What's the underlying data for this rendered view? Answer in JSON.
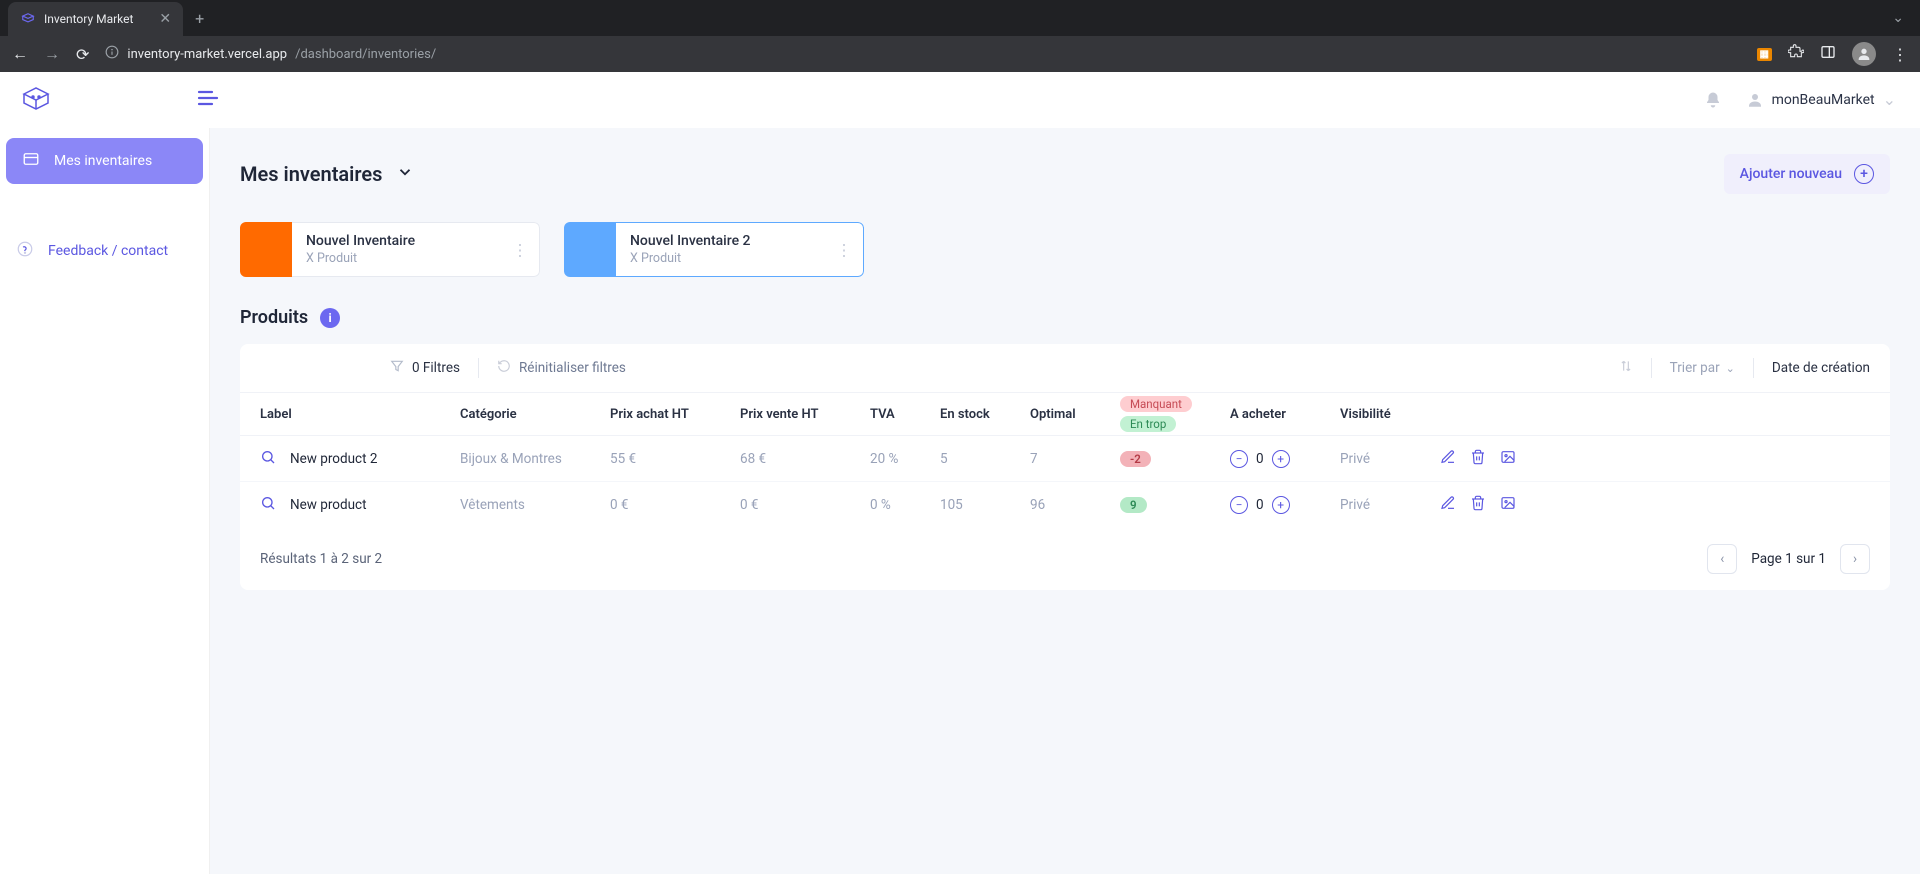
{
  "browser": {
    "tab_title": "Inventory Market",
    "url_domain": "inventory-market.vercel.app",
    "url_path": "/dashboard/inventories/"
  },
  "header": {
    "user_name": "monBeauMarket"
  },
  "sidebar": {
    "inventories_label": "Mes inventaires",
    "feedback_label": "Feedback / contact"
  },
  "page": {
    "title": "Mes inventaires",
    "add_button": "Ajouter nouveau",
    "products_title": "Produits"
  },
  "inventories": [
    {
      "title": "Nouvel Inventaire",
      "subtitle": "X Produit",
      "color": "orange",
      "active": false
    },
    {
      "title": "Nouvel Inventaire 2",
      "subtitle": "X Produit",
      "color": "blue",
      "active": true
    }
  ],
  "toolbar": {
    "filters_label": "0 Filtres",
    "reset_label": "Réinitialiser filtres",
    "sort_by_label": "Trier par",
    "sort_field": "Date de création"
  },
  "columns": {
    "label": "Label",
    "category": "Catégorie",
    "buy_price": "Prix achat HT",
    "sell_price": "Prix vente HT",
    "vat": "TVA",
    "in_stock": "En stock",
    "optimal": "Optimal",
    "missing": "Manquant",
    "excess": "En trop",
    "to_buy": "A acheter",
    "visibility": "Visibilité"
  },
  "rows": [
    {
      "label": "New product 2",
      "category": "Bijoux & Montres",
      "buy": "55 €",
      "sell": "68 €",
      "vat": "20 %",
      "stock": "5",
      "optimal": "7",
      "delta": "-2",
      "delta_kind": "red",
      "to_buy": "0",
      "visibility": "Privé"
    },
    {
      "label": "New product",
      "category": "Vêtements",
      "buy": "0 €",
      "sell": "0 €",
      "vat": "0 %",
      "stock": "105",
      "optimal": "96",
      "delta": "9",
      "delta_kind": "green",
      "to_buy": "0",
      "visibility": "Privé"
    }
  ],
  "footer": {
    "results": "Résultats 1 à 2 sur 2",
    "page_info": "Page 1 sur 1"
  }
}
